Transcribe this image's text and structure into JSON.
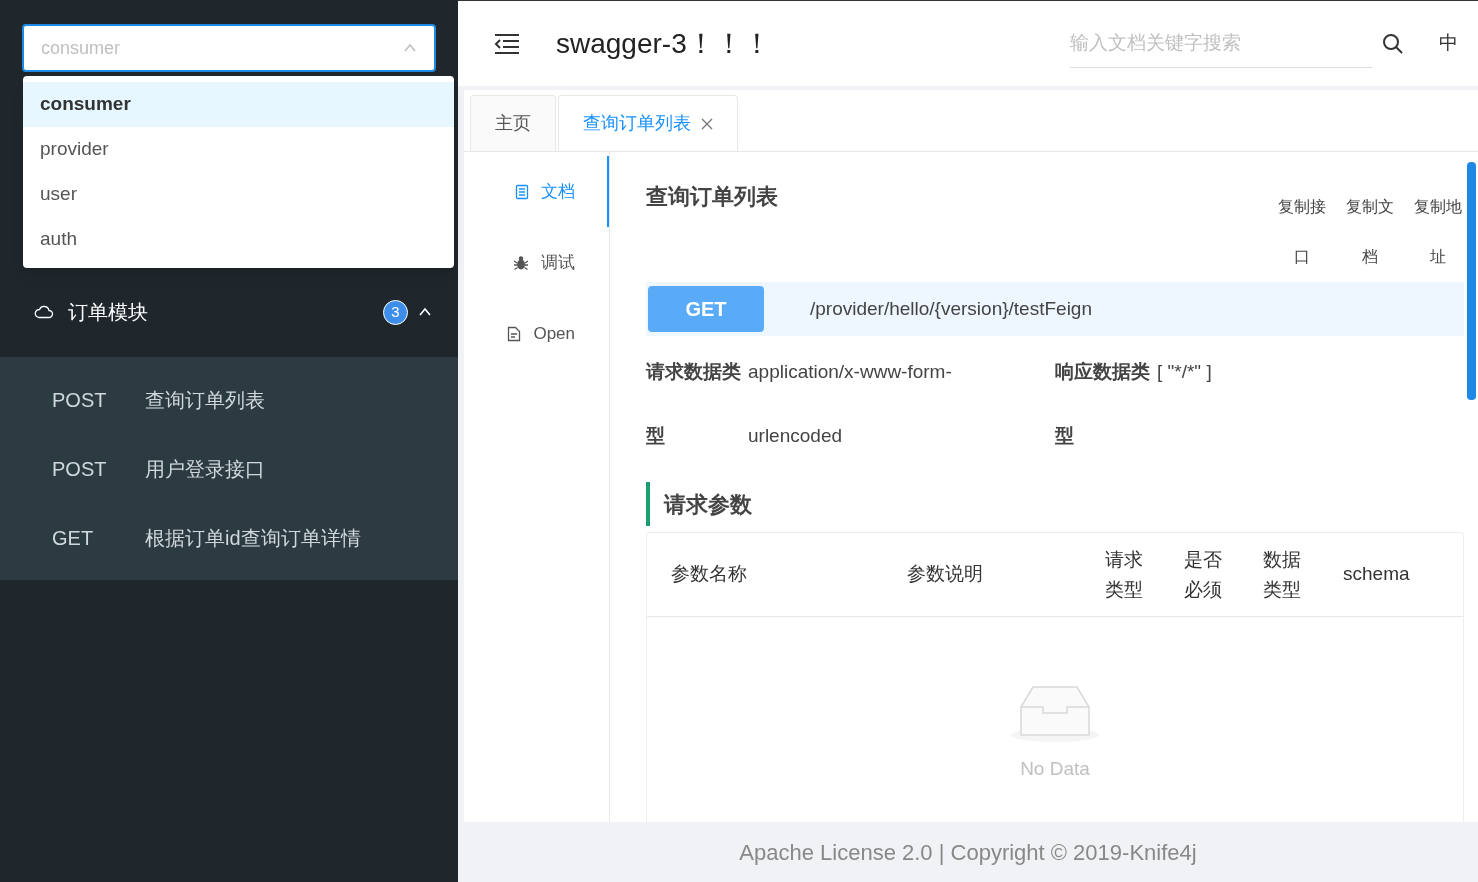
{
  "sidebar": {
    "group_select": {
      "placeholder": "consumer",
      "expanded": true,
      "options": [
        {
          "label": "consumer",
          "selected": true
        },
        {
          "label": "provider",
          "selected": false
        },
        {
          "label": "user",
          "selected": false
        },
        {
          "label": "auth",
          "selected": false
        }
      ]
    },
    "menu": [
      {
        "label": "订单模块",
        "badge": "3",
        "expanded": true,
        "children": [
          {
            "method": "POST",
            "label": "查询订单列表"
          },
          {
            "method": "POST",
            "label": "用户登录接口"
          },
          {
            "method": "GET",
            "label": "根据订单id查询订单详情"
          }
        ]
      }
    ]
  },
  "header": {
    "title": "swagger-3！！！",
    "search": {
      "placeholder": "输入文档关键字搜索"
    },
    "language": "中"
  },
  "tabs": [
    {
      "label": "主页",
      "selected": false,
      "closable": false
    },
    {
      "label": "查询订单列表",
      "selected": true,
      "closable": true
    }
  ],
  "doc_nav": [
    {
      "label": "文档",
      "kind": "doc",
      "selected": true
    },
    {
      "label": "调试",
      "kind": "debug",
      "selected": false
    },
    {
      "label": "Open",
      "kind": "open",
      "selected": false
    }
  ],
  "api": {
    "title": "查询订单列表",
    "copy_buttons": [
      "复制接口",
      "复制文档",
      "复制地址"
    ],
    "method": "GET",
    "path": "/provider/hello/{version}/testFeign",
    "request_type": {
      "label": "请求数据类型",
      "value": "application/x-www-form-urlencoded"
    },
    "response_type": {
      "label": "响应数据类型",
      "value": "[ \"*/*\" ]"
    }
  },
  "params": {
    "title": "请求参数",
    "columns": [
      "参数名称",
      "参数说明",
      "请求类型",
      "是否必须",
      "数据类型",
      "schema"
    ],
    "empty_text": "No Data"
  },
  "footer": "Apache License 2.0 | Copyright © 2019-Knife4j"
}
